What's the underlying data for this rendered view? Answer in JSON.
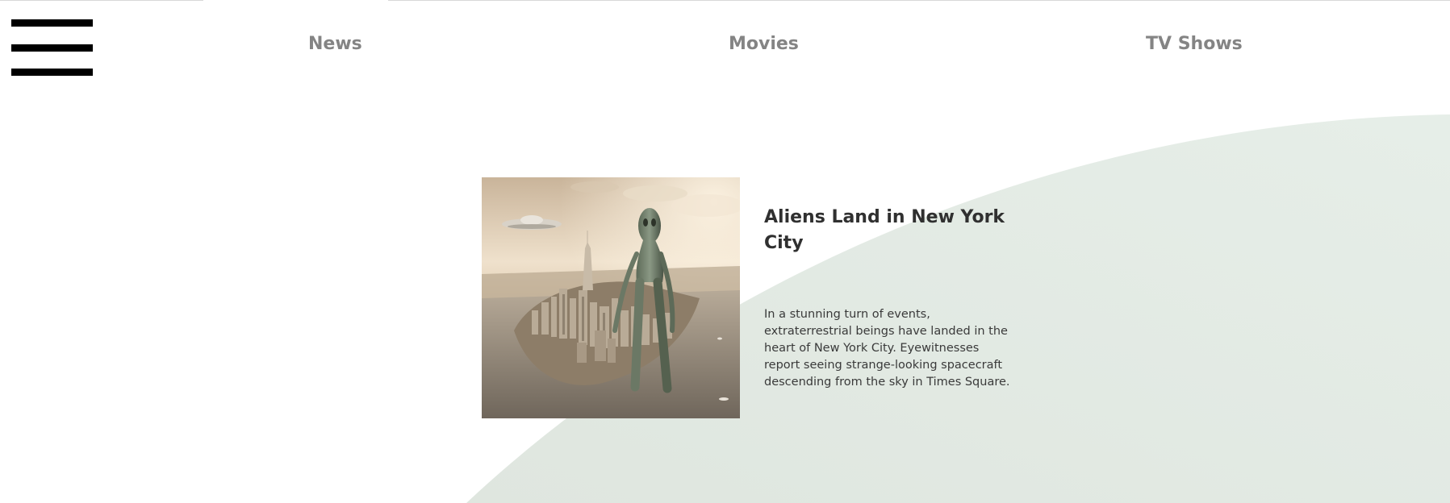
{
  "menu": {
    "icon": "hamburger-menu-icon"
  },
  "nav": {
    "news": "News",
    "movies": "Movies",
    "tv_shows": "TV Shows"
  },
  "article": {
    "title": "Aliens Land in New York City",
    "body": "In a stunning turn of events, extraterrestrial beings have landed in the heart of New York City. Eyewitnesses report seeing strange-looking spacecraft descending from the sky in Times Square.",
    "image_alt": "A giant alien walking over the Manhattan skyline with a flying saucer in the sky"
  },
  "colors": {
    "background": "#ffffff",
    "curve_fill": "#e2ebe4",
    "nav_text": "#848484",
    "title_text": "#303030",
    "body_text": "#3a3a3a",
    "menu_bars": "#000000"
  }
}
